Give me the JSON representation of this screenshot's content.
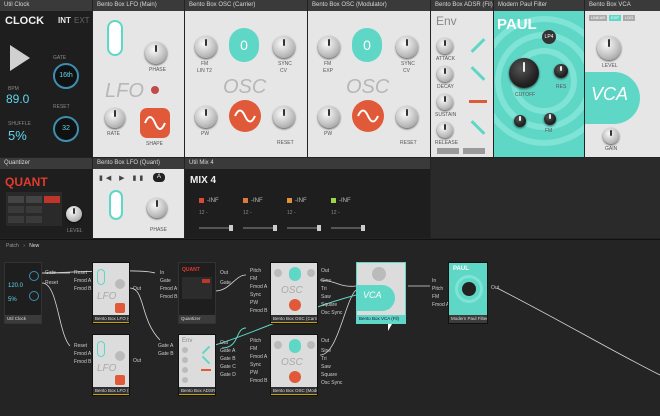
{
  "clock": {
    "title": "Util Clock",
    "name": "CLOCK",
    "mode_int": "INT",
    "mode_ext": "EXT",
    "bpm_label": "BPM",
    "bpm_value": "89.0",
    "gate_label": "GATE",
    "gate_value": "16th",
    "shuffle_label": "SHUFFLE",
    "shuffle_value": "5%",
    "reset_label": "RESET",
    "reset_value": "32"
  },
  "lfo_main": {
    "title": "Bento Box LFO (Main)",
    "name": "LFO",
    "phase_label": "PHASE",
    "shape_label": "SHAPE",
    "rate_label": "RATE"
  },
  "osc_carrier": {
    "title": "Bento Box OSC (Carrier)",
    "name": "OSC",
    "fm_label": "FM",
    "lin_label": "LIN T2",
    "sync_label": "SYNC",
    "pw_label": "PW",
    "pitch_value": "0",
    "reset_label": "RESET",
    "cv_label": "CV"
  },
  "osc_mod": {
    "title": "Bento Box OSC (Modulator)",
    "name": "OSC",
    "fm_label": "FM",
    "exp_label": "EXP",
    "sync_label": "SYNC",
    "pw_label": "PW",
    "pitch_value": "0",
    "reset_label": "RESET",
    "cv_label": "CV"
  },
  "adsr": {
    "title": "Bento Box ADSR (Fil)",
    "name": "Env",
    "attack": "ATTACK",
    "decay": "DECAY",
    "sustain": "SUSTAIN",
    "release": "RELEASE",
    "gate_label": "GATE"
  },
  "filter": {
    "title": "Modern Paul Filter",
    "name": "PAUL",
    "mode": "LP4",
    "cutoff": "CUTOFF",
    "res": "RES",
    "fm": "FM"
  },
  "vca": {
    "title": "Bento Box VCA",
    "name": "VCA",
    "tab1": "LINEAR",
    "tab2": "EXP",
    "tab3": "LOG",
    "level": "LEVEL",
    "gain": "GAIN"
  },
  "quant": {
    "title": "Quantizer",
    "name": "QUANT",
    "level_label": "LEVEL"
  },
  "lfo_quant": {
    "title": "Bento Box LFO (Quant)",
    "pitch_tag": "A",
    "name": "LFO",
    "phase_label": "PHASE",
    "rate_label": "RATE"
  },
  "mix": {
    "title": "Util Mix 4",
    "name": "MIX 4",
    "channels": [
      {
        "color": "#d94a3a",
        "value": "-INF",
        "db": "12 -"
      },
      {
        "color": "#e07a3a",
        "value": "-INF",
        "db": "12 -"
      },
      {
        "color": "#e0903a",
        "value": "-INF",
        "db": "12 -"
      },
      {
        "color": "#9ad64a",
        "value": "-INF",
        "db": "12 -"
      }
    ]
  },
  "patch": {
    "breadcrumb_root": "Patch",
    "breadcrumb_current": "New",
    "clock_value": "120.0",
    "clock_pct": "5%",
    "clock_footer": "Util Clock",
    "lfo_quant_footer": "Bento Box LFO (Quant)",
    "lfo_fil_footer": "Bento Box LFO (Fil)",
    "quant_footer": "Quantizer",
    "adsr_footer": "Bento Box ADSR (Fil)",
    "osc_car_footer": "Bento Box OSC (Carrier)",
    "osc_mod_footer": "Bento Box OSC (Modulator)",
    "vca_footer": "Bento Box VCA (Fil)",
    "filter_footer": "Modern Paul Filter",
    "ports": {
      "gate": "Gate",
      "reset": "Reset",
      "pitch": "Pitch",
      "fm": "FM",
      "fmod_a": "Fmod A",
      "fmod_b": "Fmod B",
      "in": "In",
      "out": "Out",
      "sync": "Sync",
      "pw": "PW",
      "osc_sync": "Osc Sync",
      "sine": "Sine",
      "tri": "Tri",
      "saw": "Saw",
      "square": "Square",
      "gate_a": "Gate A",
      "gate_b": "Gate B",
      "gate_c": "Gate C",
      "gate_d": "Gate D"
    }
  }
}
